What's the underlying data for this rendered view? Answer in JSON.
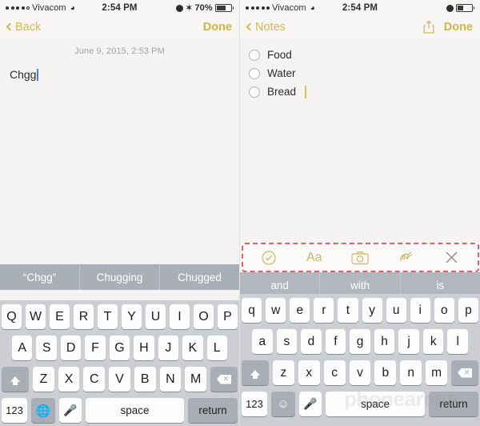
{
  "left": {
    "status": {
      "carrier": "Vivacom",
      "signal_dots_filled": 4,
      "signal_dots_total": 5,
      "wifi_icon": "wifi-icon",
      "time": "2:54 PM",
      "alarm_icon": "alarm-icon",
      "bluetooth_icon": "bluetooth-icon",
      "battery_percent": "70%",
      "battery_level": 70
    },
    "nav": {
      "back_label": "Back",
      "done_label": "Done"
    },
    "note": {
      "date": "June 9, 2015, 2:53 PM",
      "text": "Chgg"
    },
    "suggestions": [
      "“Chgg”",
      "Chugging",
      "Chugged"
    ],
    "keyboard": {
      "row1": [
        "Q",
        "W",
        "E",
        "R",
        "T",
        "Y",
        "U",
        "I",
        "O",
        "P"
      ],
      "row2": [
        "A",
        "S",
        "D",
        "F",
        "G",
        "H",
        "J",
        "K",
        "L"
      ],
      "row3": [
        "Z",
        "X",
        "C",
        "V",
        "B",
        "N",
        "M"
      ],
      "shift_icon": "shift-icon",
      "delete_icon": "backspace-icon",
      "numbers_label": "123",
      "globe_icon": "globe-icon",
      "mic_icon": "microphone-icon",
      "space_label": "space",
      "return_label": "return"
    }
  },
  "right": {
    "status": {
      "carrier": "Vivacom",
      "signal_dots_filled": 5,
      "signal_dots_total": 5,
      "wifi_icon": "wifi-icon",
      "time": "2:54 PM",
      "alarm_icon": "alarm-icon",
      "battery_level": 40
    },
    "nav": {
      "back_label": "Notes",
      "share_icon": "share-icon",
      "done_label": "Done"
    },
    "checklist": [
      {
        "label": "Food",
        "checked": false
      },
      {
        "label": "Water",
        "checked": false
      },
      {
        "label": "Bread",
        "checked": false
      }
    ],
    "format_toolbar": {
      "highlight_color": "#e0616b",
      "items": [
        {
          "name": "checklist-icon",
          "label": ""
        },
        {
          "name": "text-format-icon",
          "label": "Aa"
        },
        {
          "name": "camera-icon",
          "label": ""
        },
        {
          "name": "sketch-icon",
          "label": ""
        },
        {
          "name": "close-icon",
          "label": ""
        }
      ]
    },
    "suggestions": [
      "and",
      "with",
      "is"
    ],
    "keyboard": {
      "row1": [
        "q",
        "w",
        "e",
        "r",
        "t",
        "y",
        "u",
        "i",
        "o",
        "p"
      ],
      "row2": [
        "a",
        "s",
        "d",
        "f",
        "g",
        "h",
        "j",
        "k",
        "l"
      ],
      "row3": [
        "z",
        "x",
        "c",
        "v",
        "b",
        "n",
        "m"
      ],
      "shift_icon": "shift-icon",
      "delete_icon": "backspace-icon",
      "numbers_label": "123",
      "emoji_icon": "emoji-icon",
      "mic_icon": "microphone-icon",
      "space_label": "space",
      "return_label": "return"
    },
    "watermark": "phonearena"
  },
  "accent_color": "#d0b547"
}
